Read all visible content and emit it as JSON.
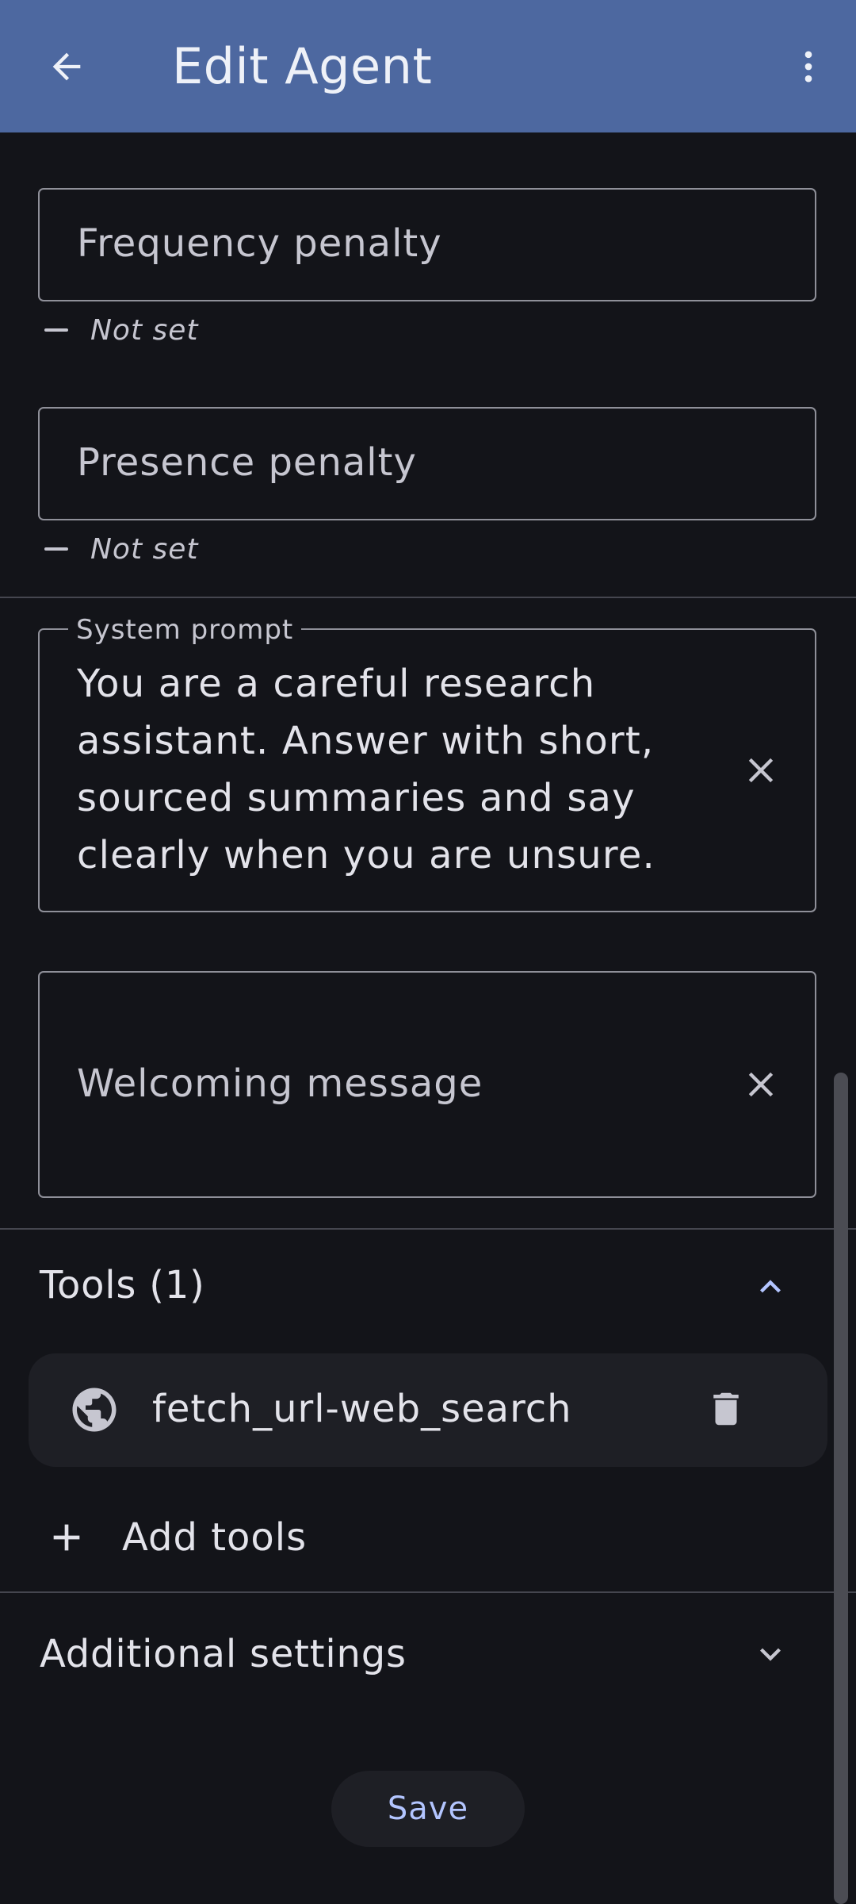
{
  "appbar": {
    "title": "Edit Agent",
    "back_icon": "arrow-back-icon",
    "more_icon": "more-vert-icon",
    "color": "#4d68a0"
  },
  "fields": {
    "frequency_penalty": {
      "placeholder": "Frequency penalty",
      "helper": "Not set"
    },
    "presence_penalty": {
      "placeholder": "Presence penalty",
      "helper": "Not set"
    },
    "system_prompt": {
      "label": "System prompt",
      "value": "You are a careful research assistant. Answer with short, sourced summaries and say clearly when you are unsure."
    },
    "welcoming_message": {
      "placeholder": "Welcoming message"
    }
  },
  "tools": {
    "title": "Tools (1)",
    "expanded": true,
    "items": [
      {
        "name": "fetch_url-web_search",
        "icon": "globe-icon"
      }
    ],
    "add_label": "Add tools"
  },
  "additional_settings": {
    "title": "Additional settings",
    "expanded": false
  },
  "save_label": "Save",
  "colors": {
    "background": "#131419",
    "accent": "#b3c5ff",
    "outline": "#8f9099"
  }
}
